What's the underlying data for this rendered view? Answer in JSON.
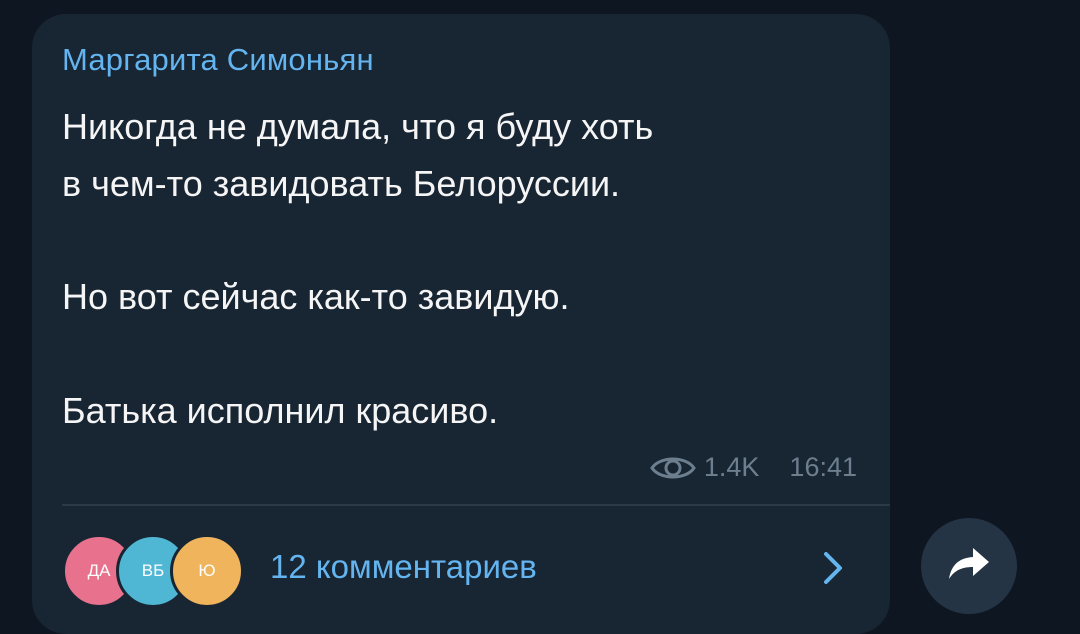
{
  "message": {
    "sender": "Маргарита Симоньян",
    "lines": [
      "Никогда не думала, что я буду хоть",
      "в чем-то завидовать Белоруссии.",
      "Но вот сейчас как-то завидую.",
      "Батька исполнил красиво."
    ],
    "views": "1.4K",
    "time": "16:41"
  },
  "comments": {
    "avatars": [
      "ДА",
      "ВБ",
      "Ю"
    ],
    "label": "12 комментариев"
  },
  "icons": {
    "views": "eye-icon",
    "open_comments": "chevron-right-icon",
    "share": "share-arrow-icon"
  },
  "colors": {
    "background": "#0e1621",
    "bubble": "#182533",
    "accent": "#64b5ef",
    "text": "#f5f5f5",
    "meta": "#6d7f8f"
  }
}
